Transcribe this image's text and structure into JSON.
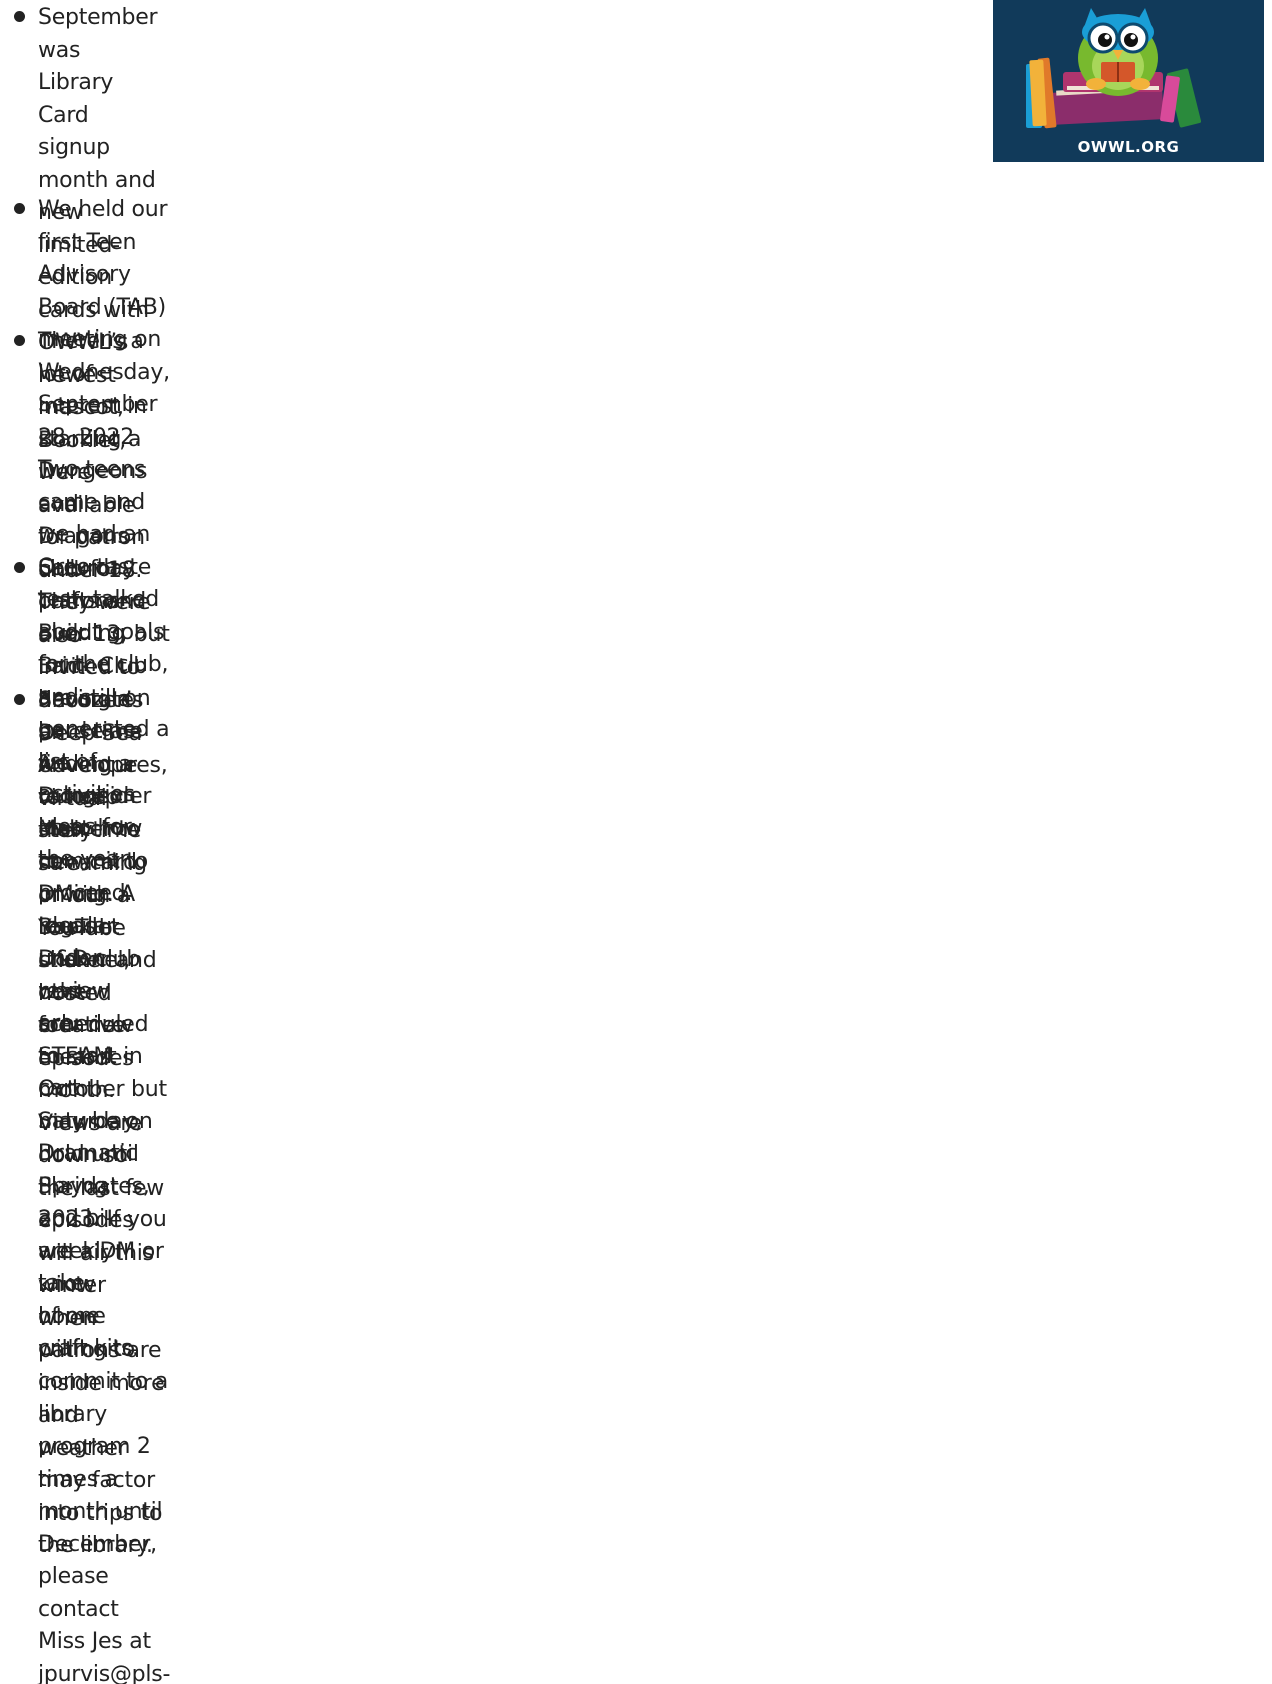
{
  "bullets": [
    {
      "text": "September was Library Card signup month and new limited-edition\ncards with OWWL’s newest mascot, Booklet, were available for patron\nunder 18. They were also invited to decorate an envelope to keep their\nnew card in with a Booklet sticker and other creative means."
    },
    {
      "text": "We held our first Teen Advisory Board (TAB) meeting on Wednesday, September 28, 2022.\nTwo teens came and we had an Oreo taste test, talked about goals for the club, and\ngenerated a list of activities ideas for the year."
    },
    {
      "text": "There is a lot of interest in starting a Dungeons and Dragons club for patrons over 13, but I am\nhaving a hard time finding a Dungeon Master to commit to DMing. A regular D&D club was\nscheduled to start in October but may be on hold until Spring 2023. If you are a DM or know\nof one willing to commit to a library program 2 times a month until December, please contact\nMiss Jes at jpurvis@pls-net.org."
    },
    {
      "text": "Saturday crafts and Building Brick Club are still on pause as we reconsider as to how to\nproceed. Ideas under review are: STEAM cart Saturday, Dramatic Playdates, and bi-weekly\ntake home craft kits."
    },
    {
      "text": "Snoozer’s Deep Sea Adventures, virtual storytime streaming on our YouTube channel, hosted\nfour new episodes month. Views are down so the last few episodes will air this winter when\npatrons are inside more and weather may factor into trips to the library."
    }
  ],
  "logo": {
    "caption": "OWWL.ORG",
    "icon": "owl-on-books-mascot",
    "background_color": "#113a5a"
  }
}
